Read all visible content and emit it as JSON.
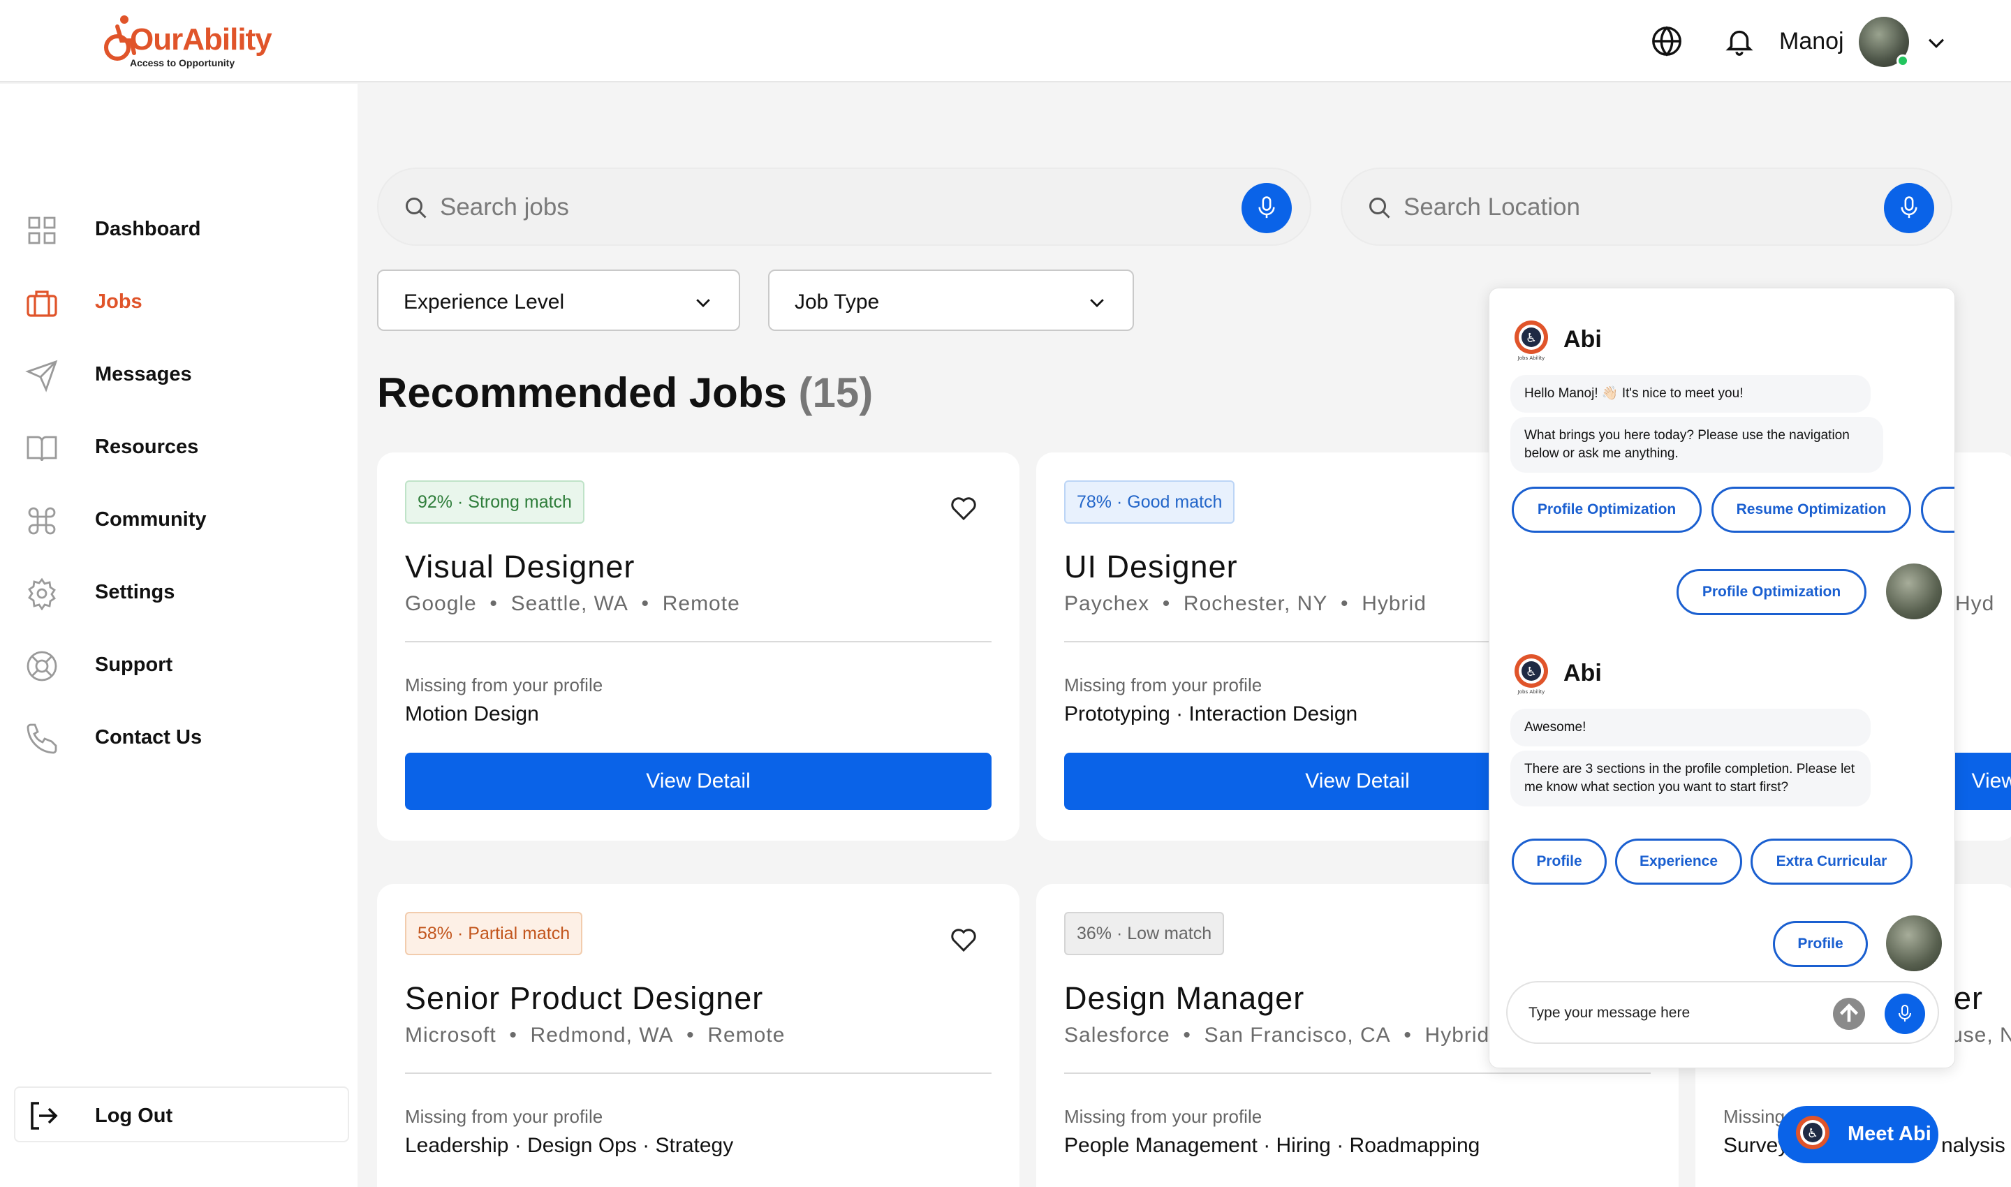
{
  "brand": {
    "name": "OurAbility",
    "tagline": "Access to Opportunity",
    "color": "#e0542a"
  },
  "header": {
    "user_name": "Manoj"
  },
  "sidebar": {
    "items": [
      {
        "label": "Dashboard",
        "icon": "grid-icon"
      },
      {
        "label": "Jobs",
        "icon": "briefcase-icon",
        "active": true
      },
      {
        "label": "Messages",
        "icon": "send-icon"
      },
      {
        "label": "Resources",
        "icon": "book-icon"
      },
      {
        "label": "Community",
        "icon": "command-icon"
      },
      {
        "label": "Settings",
        "icon": "gear-icon"
      },
      {
        "label": "Support",
        "icon": "lifebuoy-icon"
      },
      {
        "label": "Contact Us",
        "icon": "phone-icon"
      }
    ],
    "logout_label": "Log Out"
  },
  "search": {
    "jobs_placeholder": "Search jobs",
    "location_placeholder": "Search Location"
  },
  "filters": {
    "experience_label": "Experience Level",
    "job_type_label": "Job Type"
  },
  "section": {
    "title": "Recommended Jobs",
    "count": "(15)"
  },
  "jobs": [
    {
      "match_pct": "92%",
      "match_label": "Strong match",
      "title": "Visual Designer",
      "company": "Google",
      "location": "Seattle, WA",
      "mode": "Remote",
      "missing_label": "Missing from your profile",
      "missing": "Motion Design",
      "button": "View Detail"
    },
    {
      "match_pct": "78%",
      "match_label": "Good match",
      "title": "UI Designer",
      "company": "Paychex",
      "location": "Rochester, NY",
      "mode": "Hybrid",
      "missing_label": "Missing from your profile",
      "missing": "Prototyping · Interaction Design",
      "button": "View Detail"
    },
    {
      "match_pct": "58%",
      "match_label": "Partial match",
      "title": "Senior Product Designer",
      "company": "Microsoft",
      "location": "Redmond, WA",
      "mode": "Remote",
      "missing_label": "Missing from your profile",
      "missing": "Leadership · Design Ops · Strategy"
    },
    {
      "match_pct": "36%",
      "match_label": "Low match",
      "title": "Design Manager",
      "company": "Salesforce",
      "location": "San Francisco, CA",
      "mode": "Hybrid",
      "missing_label": "Missing from your profile",
      "missing": "People Management · Hiring · Roadmapping"
    }
  ],
  "partial_column": {
    "meta_fragment": "w Hyd",
    "button_fragment": "View",
    "title_fragment": "er",
    "meta_fragment_2": "use, N",
    "missing_fragment": "Missing",
    "missing_val_fragment": "Survey",
    "missing_val_fragment_2": "nalysis"
  },
  "chat": {
    "bot_name": "Abi",
    "bot_logo_text": "Jobs Ability",
    "greeting": "Hello Manoj! 👋🏻 It's nice to meet you!",
    "question": "What brings you here today? Please use the navigation below or ask me anything.",
    "options_1": [
      "Profile Optimization",
      "Resume Optimization"
    ],
    "user_reply_1": "Profile Optimization",
    "reply_2": "Awesome!",
    "sections_msg": "There are 3 sections in the profile completion. Please let me know what section you want to start first?",
    "options_2": [
      "Profile",
      "Experience",
      "Extra Curricular"
    ],
    "user_reply_2": "Profile",
    "input_placeholder": "Type your message here"
  },
  "meet_abi": {
    "label": "Meet Abi"
  },
  "colors": {
    "primary": "#0a63e8",
    "accent": "#e0542a"
  }
}
